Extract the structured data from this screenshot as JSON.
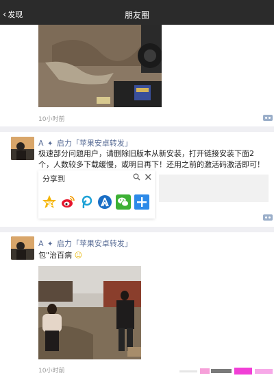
{
  "nav": {
    "back_label": "发现",
    "title": "朋友圈"
  },
  "posts": [
    {
      "time": "10小时前"
    },
    {
      "name": "A",
      "tag": "启力「苹果安卓转发」",
      "text": "极速部分问题用户，请删除旧版本从新安装，打开链接安装下面2个，人数较多下载缓慢，或明日再下！还用之前的激活码激活即可！",
      "share": {
        "title": "分享到"
      }
    },
    {
      "name": "A",
      "tag": "启力「苹果安卓转发」",
      "text": "包\"治百病",
      "time": "10小时前"
    }
  ],
  "icons": {
    "share_icons": [
      "qzone-icon",
      "weibo-icon",
      "tencent-weibo-icon",
      "renren-icon",
      "wechat-icon",
      "more-plus-icon"
    ]
  },
  "colors": {
    "nav_bg": "#2b2b2b",
    "link": "#576b95",
    "divider": "#efeff3",
    "time": "#9a9a9a"
  }
}
